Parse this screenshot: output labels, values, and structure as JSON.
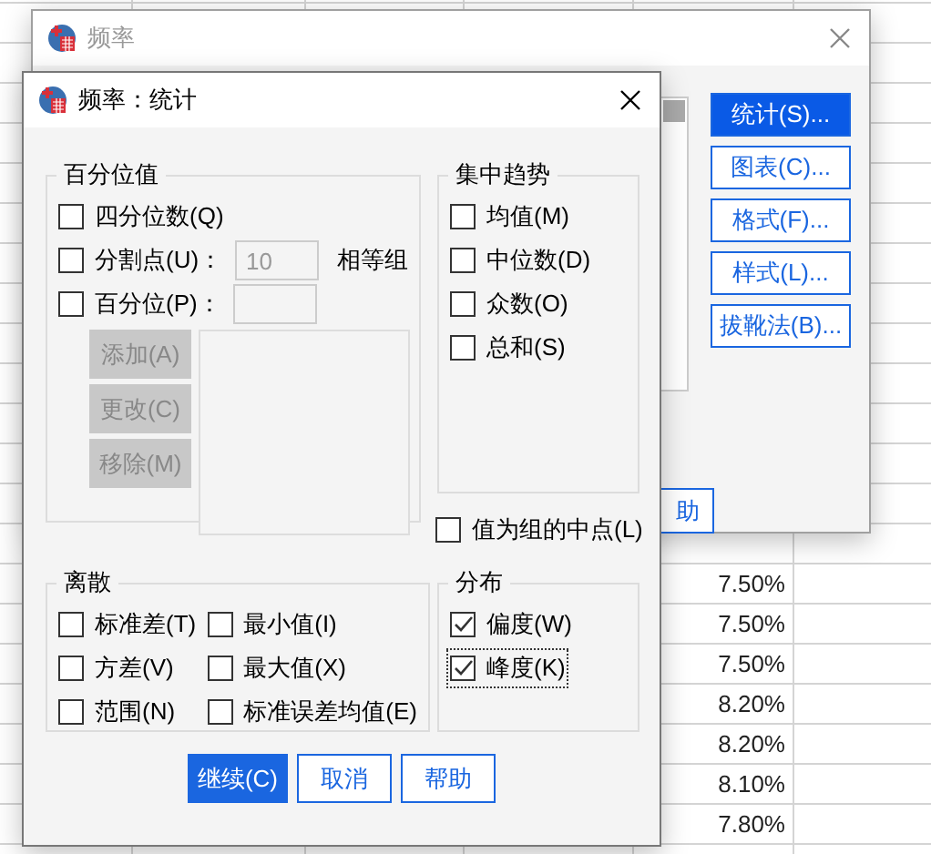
{
  "sheet": {
    "cells": [
      {
        "text": "7.50%"
      },
      {
        "text": "7.50%"
      },
      {
        "text": "7.50%"
      },
      {
        "text": "8.20%"
      },
      {
        "text": "8.20%"
      },
      {
        "text": "8.10%"
      },
      {
        "text": "7.80%"
      }
    ]
  },
  "back_dialog": {
    "title": "频率",
    "buttons": [
      {
        "label": "统计(S)...",
        "selected": true
      },
      {
        "label": "图表(C)...",
        "selected": false
      },
      {
        "label": "格式(F)...",
        "selected": false
      },
      {
        "label": "样式(L)...",
        "selected": false
      },
      {
        "label": "拔靴法(B)...",
        "selected": false
      }
    ],
    "help_button": "助"
  },
  "dialog": {
    "title": "频率：统计",
    "percentile": {
      "title": "百分位值",
      "quartiles": {
        "label": "四分位数(Q)",
        "checked": false
      },
      "cut_points": {
        "label": "分割点(U)：",
        "checked": false,
        "value": "10",
        "suffix": "相等组"
      },
      "percentiles": {
        "label": "百分位(P)：",
        "checked": false
      },
      "buttons": [
        {
          "label": "添加(A)",
          "disabled": true
        },
        {
          "label": "更改(C)",
          "disabled": true
        },
        {
          "label": "移除(M)",
          "disabled": true
        }
      ]
    },
    "central_tendency": {
      "title": "集中趋势",
      "items": [
        {
          "label": "均值(M)",
          "checked": false
        },
        {
          "label": "中位数(D)",
          "checked": false
        },
        {
          "label": "众数(O)",
          "checked": false
        },
        {
          "label": "总和(S)",
          "checked": false
        }
      ]
    },
    "midpoint": {
      "label": "值为组的中点(L)",
      "checked": false
    },
    "dispersion": {
      "title": "离散",
      "items": [
        {
          "label": "标准差(T)",
          "checked": false
        },
        {
          "label": "最小值(I)",
          "checked": false
        },
        {
          "label": "方差(V)",
          "checked": false
        },
        {
          "label": "最大值(X)",
          "checked": false
        },
        {
          "label": "范围(N)",
          "checked": false
        },
        {
          "label": "标准误差均值(E)",
          "checked": false
        }
      ]
    },
    "distribution": {
      "title": "分布",
      "items": [
        {
          "label": "偏度(W)",
          "checked": true,
          "focused": false
        },
        {
          "label": "峰度(K)",
          "checked": true,
          "focused": true
        }
      ]
    },
    "buttons": [
      {
        "label": "继续(C)",
        "kind": "primary"
      },
      {
        "label": "取消",
        "kind": "normal"
      },
      {
        "label": "帮助",
        "kind": "normal"
      }
    ]
  }
}
